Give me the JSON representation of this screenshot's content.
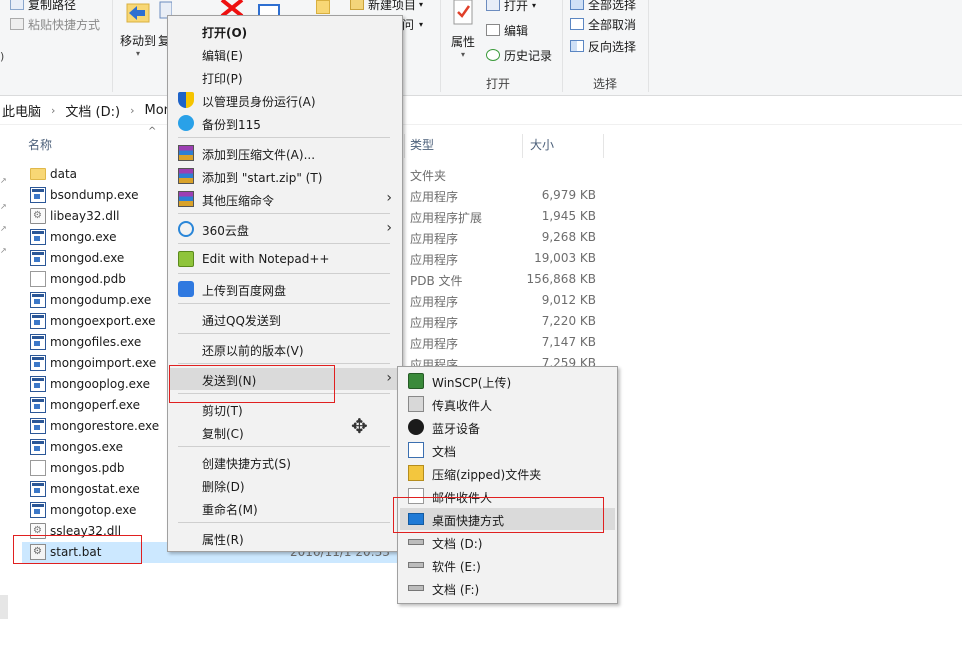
{
  "ribbon": {
    "copy_path": "复制路径",
    "paste_shortcut": "粘贴快捷方式",
    "move_to": "移动到",
    "copy_to_partial": "复",
    "new_item": "新建项目",
    "easy_access_partial": "问",
    "open": "打开",
    "edit": "编辑",
    "history": "历史记录",
    "properties": "属性",
    "select_all": "全部选择",
    "select_none": "全部取消",
    "invert_selection": "反向选择",
    "group_open": "打开",
    "group_select": "选择"
  },
  "address": {
    "crumbs": [
      "此电脑",
      "文档 (D:)",
      "Mongo"
    ]
  },
  "columns": {
    "name": "名称",
    "type": "类型",
    "size": "大小"
  },
  "files": [
    {
      "name": "data",
      "icon": "folder-icon",
      "type": "文件夹",
      "size": ""
    },
    {
      "name": "bsondump.exe",
      "icon": "exe-icon",
      "type": "应用程序",
      "size": "6,979 KB"
    },
    {
      "name": "libeay32.dll",
      "icon": "dll-icon",
      "type": "应用程序扩展",
      "size": "1,945 KB"
    },
    {
      "name": "mongo.exe",
      "icon": "exe-icon",
      "type": "应用程序",
      "size": "9,268 KB"
    },
    {
      "name": "mongod.exe",
      "icon": "exe-icon",
      "type": "应用程序",
      "size": "19,003 KB"
    },
    {
      "name": "mongod.pdb",
      "icon": "file-icon",
      "type": "PDB 文件",
      "size": "156,868 KB"
    },
    {
      "name": "mongodump.exe",
      "icon": "exe-icon",
      "type": "应用程序",
      "size": "9,012 KB"
    },
    {
      "name": "mongoexport.exe",
      "icon": "exe-icon",
      "type": "应用程序",
      "size": "7,220 KB"
    },
    {
      "name": "mongofiles.exe",
      "icon": "exe-icon",
      "type": "应用程序",
      "size": "7,147 KB"
    },
    {
      "name": "mongoimport.exe",
      "icon": "exe-icon",
      "type": "应用程序",
      "size": "7,259 KB"
    },
    {
      "name": "mongooplog.exe",
      "icon": "exe-icon",
      "type": "",
      "size": ""
    },
    {
      "name": "mongoperf.exe",
      "icon": "exe-icon",
      "type": "",
      "size": ""
    },
    {
      "name": "mongorestore.exe",
      "icon": "exe-icon",
      "type": "",
      "size": ""
    },
    {
      "name": "mongos.exe",
      "icon": "exe-icon",
      "type": "",
      "size": ""
    },
    {
      "name": "mongos.pdb",
      "icon": "file-icon",
      "type": "",
      "size": ""
    },
    {
      "name": "mongostat.exe",
      "icon": "exe-icon",
      "type": "",
      "size": ""
    },
    {
      "name": "mongotop.exe",
      "icon": "exe-icon",
      "type": "",
      "size": ""
    },
    {
      "name": "ssleay32.dll",
      "icon": "dll-icon",
      "type": "",
      "size": ""
    },
    {
      "name": "start.bat",
      "icon": "bat-icon",
      "type": "",
      "size": "",
      "date": "2016/11/1 20:33"
    }
  ],
  "context_menu": {
    "open": "打开(O)",
    "edit": "编辑(E)",
    "print": "打印(P)",
    "run_as_admin": "以管理员身份运行(A)",
    "backup_115": "备份到115",
    "add_to_archive": "添加到压缩文件(A)...",
    "add_to_zip": "添加到 \"start.zip\" (T)",
    "other_compress": "其他压缩命令",
    "cloud_360": "360云盘",
    "edit_npp": "Edit with Notepad++",
    "upload_baidu": "上传到百度网盘",
    "send_via_qq": "通过QQ发送到",
    "restore_previous": "还原以前的版本(V)",
    "send_to": "发送到(N)",
    "cut": "剪切(T)",
    "copy": "复制(C)",
    "create_shortcut": "创建快捷方式(S)",
    "delete": "删除(D)",
    "rename": "重命名(M)",
    "properties": "属性(R)"
  },
  "send_to_menu": {
    "winscp": "WinSCP(上传)",
    "fax": "传真收件人",
    "bluetooth": "蓝牙设备",
    "documents": "文档",
    "zip_folder": "压缩(zipped)文件夹",
    "mail": "邮件收件人",
    "desktop_shortcut": "桌面快捷方式",
    "drive_d": "文档 (D:)",
    "drive_e": "软件 (E:)",
    "drive_f": "文档 (F:)"
  },
  "colors": {
    "selection": "#cce8ff",
    "menu_bg": "#f2f2f2",
    "menu_hover": "#dadada",
    "annotation_red": "#e02020",
    "header_text": "#4c607a"
  }
}
